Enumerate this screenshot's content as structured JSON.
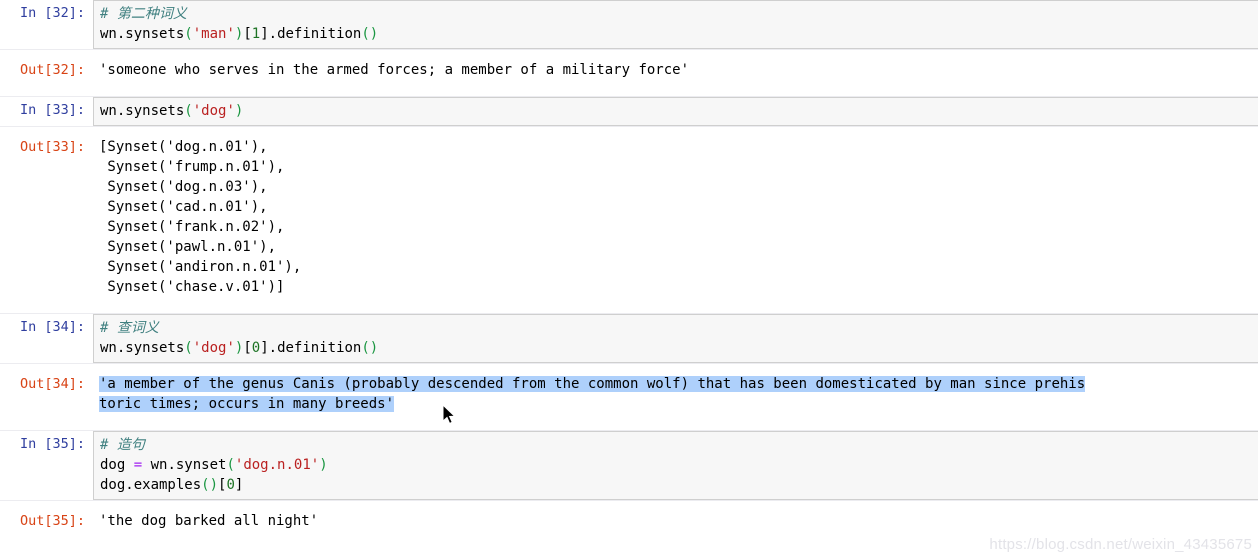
{
  "notebook": {
    "cells": [
      {
        "type": "input",
        "prompt": "In [32]:",
        "lines": [
          [
            {
              "text": "# 第二种词义",
              "cls": "tok-comment"
            }
          ],
          [
            {
              "text": "wn.synsets",
              "cls": "tok-plain"
            },
            {
              "text": "(",
              "cls": "tok-punct"
            },
            {
              "text": "'man'",
              "cls": "tok-string"
            },
            {
              "text": ")",
              "cls": "tok-punct"
            },
            {
              "text": "[",
              "cls": "tok-plain"
            },
            {
              "text": "1",
              "cls": "tok-number"
            },
            {
              "text": "]",
              "cls": "tok-plain"
            },
            {
              "text": ".definition",
              "cls": "tok-plain"
            },
            {
              "text": "()",
              "cls": "tok-punct"
            }
          ]
        ]
      },
      {
        "type": "output",
        "prompt": "Out[32]:",
        "lines": [
          "'someone who serves in the armed forces; a member of a military force'"
        ]
      },
      {
        "type": "input",
        "prompt": "In [33]:",
        "lines": [
          [
            {
              "text": "wn.synsets",
              "cls": "tok-plain"
            },
            {
              "text": "(",
              "cls": "tok-punct"
            },
            {
              "text": "'dog'",
              "cls": "tok-string"
            },
            {
              "text": ")",
              "cls": "tok-punct"
            }
          ]
        ]
      },
      {
        "type": "output",
        "prompt": "Out[33]:",
        "lines": [
          "[Synset('dog.n.01'),",
          " Synset('frump.n.01'),",
          " Synset('dog.n.03'),",
          " Synset('cad.n.01'),",
          " Synset('frank.n.02'),",
          " Synset('pawl.n.01'),",
          " Synset('andiron.n.01'),",
          " Synset('chase.v.01')]"
        ]
      },
      {
        "type": "input",
        "prompt": "In [34]:",
        "lines": [
          [
            {
              "text": "# 查词义",
              "cls": "tok-comment"
            }
          ],
          [
            {
              "text": "wn.synsets",
              "cls": "tok-plain"
            },
            {
              "text": "(",
              "cls": "tok-punct"
            },
            {
              "text": "'dog'",
              "cls": "tok-string"
            },
            {
              "text": ")",
              "cls": "tok-punct"
            },
            {
              "text": "[",
              "cls": "tok-plain"
            },
            {
              "text": "0",
              "cls": "tok-number"
            },
            {
              "text": "]",
              "cls": "tok-plain"
            },
            {
              "text": ".definition",
              "cls": "tok-plain"
            },
            {
              "text": "()",
              "cls": "tok-punct"
            }
          ]
        ]
      },
      {
        "type": "output-selected",
        "prompt": "Out[34]:",
        "lines": [
          "'a member of the genus Canis (probably descended from the common wolf) that has been domesticated by man since prehis",
          "toric times; occurs in many breeds'"
        ]
      },
      {
        "type": "input",
        "prompt": "In [35]:",
        "lines": [
          [
            {
              "text": "# 造句",
              "cls": "tok-comment"
            }
          ],
          [
            {
              "text": "dog ",
              "cls": "tok-plain"
            },
            {
              "text": "=",
              "cls": "tok-op"
            },
            {
              "text": " wn.synset",
              "cls": "tok-plain"
            },
            {
              "text": "(",
              "cls": "tok-punct"
            },
            {
              "text": "'dog.n.01'",
              "cls": "tok-string"
            },
            {
              "text": ")",
              "cls": "tok-punct"
            }
          ],
          [
            {
              "text": "dog.examples",
              "cls": "tok-plain"
            },
            {
              "text": "()",
              "cls": "tok-punct"
            },
            {
              "text": "[",
              "cls": "tok-plain"
            },
            {
              "text": "0",
              "cls": "tok-number"
            },
            {
              "text": "]",
              "cls": "tok-plain"
            }
          ]
        ]
      },
      {
        "type": "output",
        "prompt": "Out[35]:",
        "lines": [
          "'the dog barked all night'"
        ]
      }
    ]
  },
  "watermark": {
    "text": "https://blog.csdn.net/weixin_43435675"
  },
  "colors": {
    "in_prompt": "#303f9f",
    "out_prompt": "#d84315",
    "selection": "#aed0fb",
    "input_bg": "#f7f7f7",
    "comment": "#408080",
    "string": "#ba2121",
    "number": "#1d7324",
    "operator": "#a020f0"
  }
}
